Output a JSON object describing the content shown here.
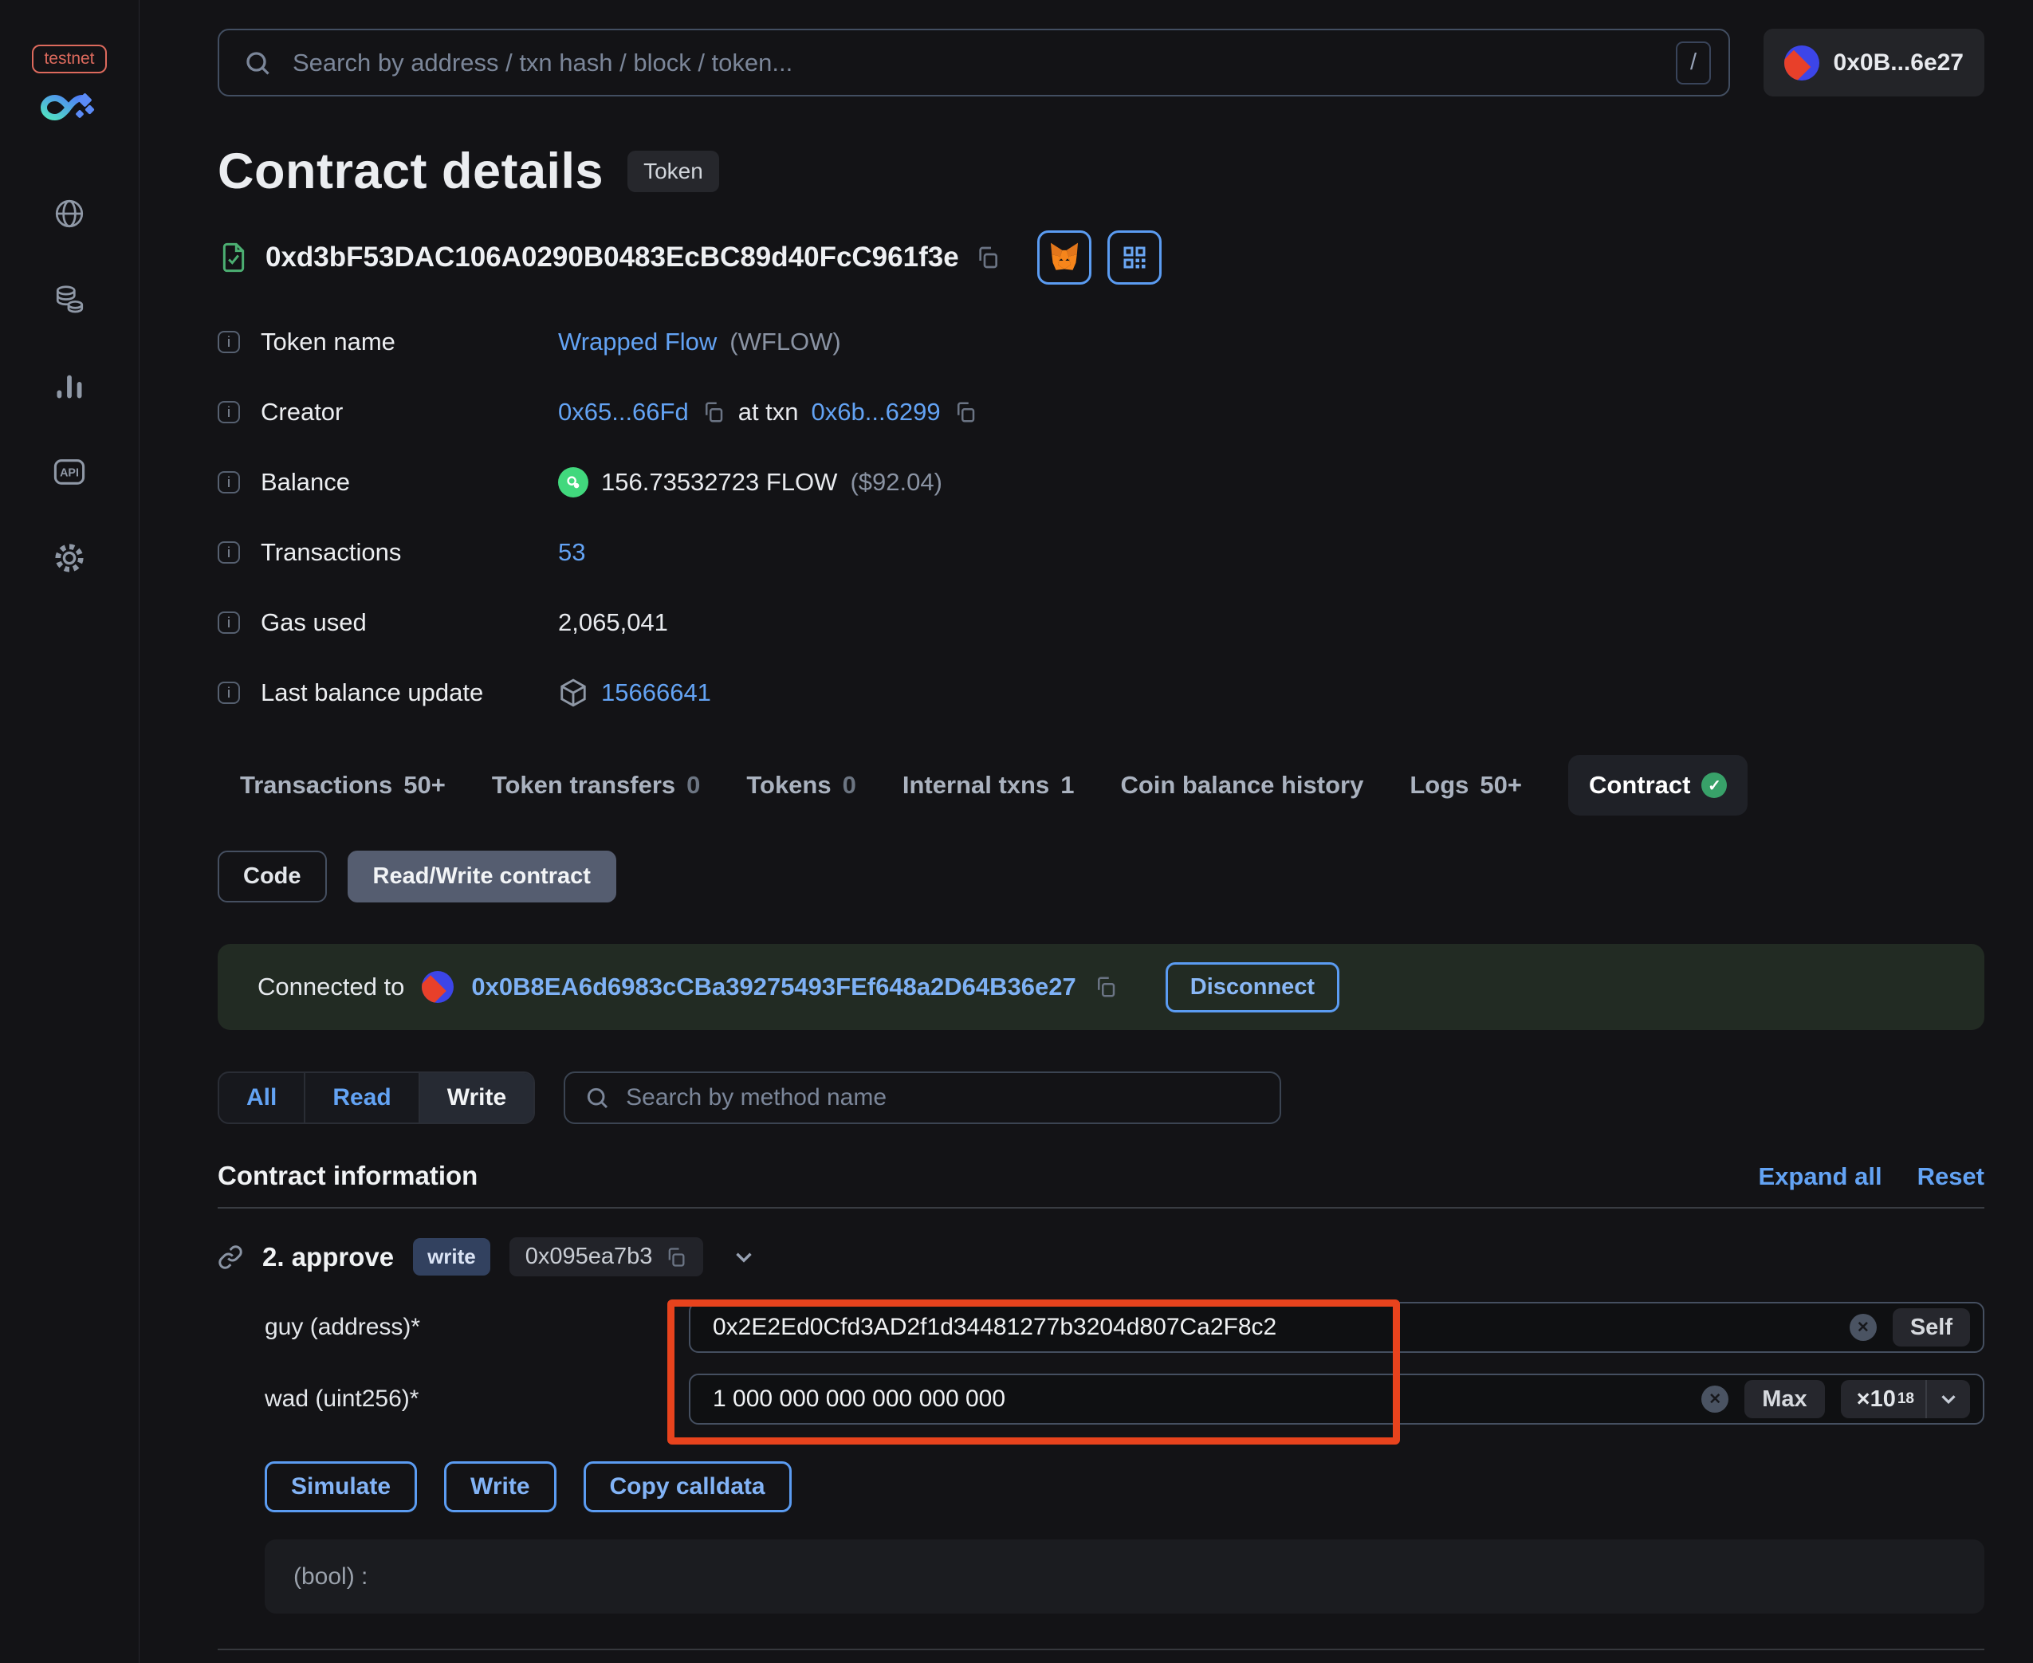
{
  "colors": {
    "accent_blue": "#63a3f4",
    "annotation_red": "#e8431d",
    "success_green": "#41d87d",
    "banner_green": "#222b23",
    "write_badge_blue": "#32415f"
  },
  "sidebar": {
    "network_badge": "testnet",
    "items": [
      {
        "icon": "globe-icon"
      },
      {
        "icon": "tokens-icon"
      },
      {
        "icon": "charts-icon"
      },
      {
        "icon": "api-icon",
        "label": "API"
      },
      {
        "icon": "settings-icon"
      }
    ]
  },
  "topbar": {
    "search_placeholder": "Search by address / txn hash / block / token...",
    "search_shortcut": "/",
    "account_label": "0x0B...6e27"
  },
  "header": {
    "title": "Contract details",
    "type_badge": "Token",
    "address": "0xd3bF53DAC106A0290B0483EcBC89d40FcC961f3e"
  },
  "info": {
    "token_name": {
      "label": "Token name",
      "link": "Wrapped Flow",
      "symbol": "(WFLOW)"
    },
    "creator": {
      "label": "Creator",
      "address": "0x65...66Fd",
      "middle": "at txn",
      "txn": "0x6b...6299"
    },
    "balance": {
      "label": "Balance",
      "value": "156.73532723 FLOW",
      "usd": "($92.04)"
    },
    "transactions": {
      "label": "Transactions",
      "value": "53"
    },
    "gas_used": {
      "label": "Gas used",
      "value": "2,065,041"
    },
    "last_balance_update": {
      "label": "Last balance update",
      "block": "15666641"
    }
  },
  "tabs": [
    {
      "label": "Transactions",
      "count": "50+"
    },
    {
      "label": "Token transfers",
      "count": "0"
    },
    {
      "label": "Tokens",
      "count": "0"
    },
    {
      "label": "Internal txns",
      "count": "1"
    },
    {
      "label": "Coin balance history",
      "count": ""
    },
    {
      "label": "Logs",
      "count": "50+"
    },
    {
      "label": "Contract",
      "count": ""
    }
  ],
  "subtabs": {
    "code": "Code",
    "read_write": "Read/Write contract"
  },
  "connection": {
    "prefix": "Connected to",
    "address": "0x0B8EA6d6983cCBa39275493FEf648a2D64B36e27",
    "disconnect": "Disconnect"
  },
  "filter": {
    "all": "All",
    "read": "Read",
    "write": "Write",
    "search_placeholder": "Search by method name"
  },
  "section": {
    "title": "Contract information",
    "expand_all": "Expand all",
    "reset": "Reset"
  },
  "method": {
    "title": "2. approve",
    "badge": "write",
    "selector": "0x095ea7b3",
    "fields": {
      "guy": {
        "label": "guy (address)*",
        "value": "0x2E2Ed0Cfd3AD2f1d34481277b3204d807Ca2F8c2",
        "action": "Self"
      },
      "wad": {
        "label": "wad (uint256)*",
        "value": "1 000 000 000 000 000 000",
        "action": "Max",
        "multiplier": "×10",
        "exponent": "18"
      }
    },
    "buttons": {
      "simulate": "Simulate",
      "write": "Write",
      "copy_calldata": "Copy calldata"
    },
    "output": "(bool) :"
  }
}
